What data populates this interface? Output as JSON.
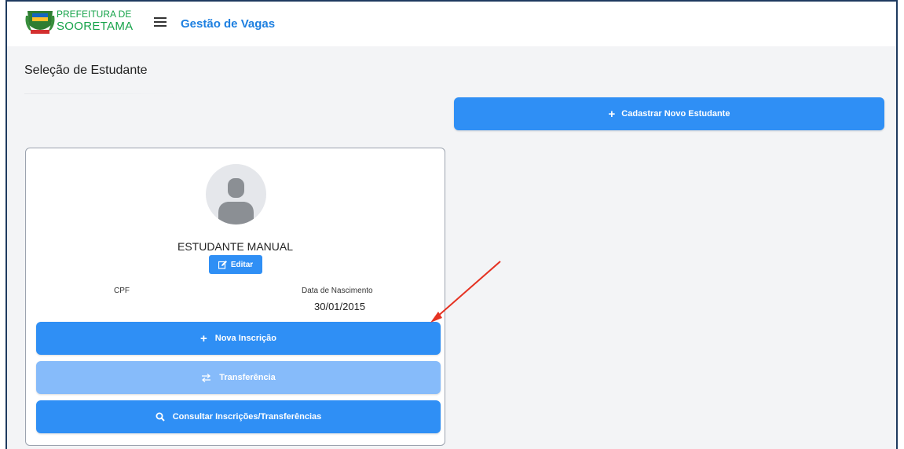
{
  "header": {
    "logo_line1": "PREFEITURA DE",
    "logo_line2": "SOORETAMA",
    "app_title": "Gestão de Vagas",
    "menu_icon": "hamburger-menu-icon"
  },
  "page": {
    "title": "Seleção de Estudante",
    "new_student_button": "Cadastrar Novo Estudante"
  },
  "student": {
    "name": "ESTUDANTE MANUAL",
    "edit_button": "Editar",
    "cpf_label": "CPF",
    "dob_label": "Data de Nascimento",
    "dob_value": "30/01/2015"
  },
  "actions": {
    "new_enrollment": "Nova Inscrição",
    "transfer": "Transferência",
    "consult": "Consultar Inscrições/Transferências"
  },
  "colors": {
    "primary": "#2f8ff5",
    "disabled": "#86bbfa",
    "brand_green": "#16a34a",
    "title_blue": "#1d7fe0",
    "annotation_arrow": "#e53222"
  }
}
